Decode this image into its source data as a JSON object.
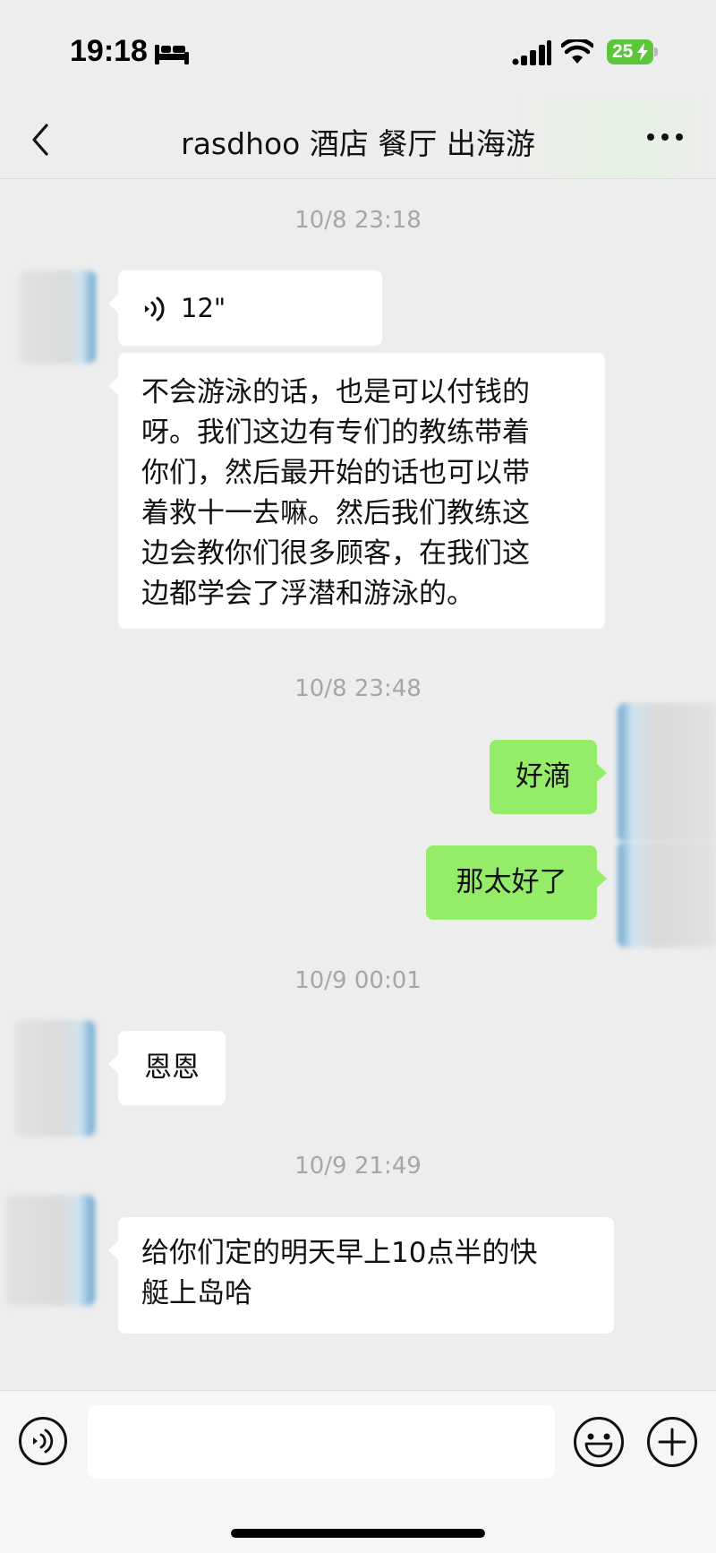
{
  "status_bar": {
    "time": "19:18",
    "battery": "25"
  },
  "nav": {
    "title": "rasdhoo  酒店 餐厅 出海游"
  },
  "messages": {
    "ts1": "10/8 23:18",
    "voice_duration": "12\"",
    "m1_lines": [
      "不会游泳的话，也是可以付钱的",
      "呀。我们这边有专们的教练带着",
      "你们，然后最开始的话也可以带",
      "着救十一去嘛。然后我们教练这",
      "边会教你们很多顾客，在我们这",
      "边都学会了浮潜和游泳的。"
    ],
    "ts2": "10/8 23:48",
    "m2": "好滴",
    "m3": "那太好了",
    "ts3": "10/9 00:01",
    "m4": "恩恩",
    "ts4": "10/9 21:49",
    "m5_lines": [
      "给你们定的明天早上10点半的快",
      "艇上岛哈"
    ]
  },
  "colors": {
    "background": "#ededed",
    "incoming_bubble": "#ffffff",
    "outgoing_bubble": "#95ec69",
    "battery": "#5cc63b"
  },
  "icons": [
    "bed-icon",
    "signal-icon",
    "wifi-icon",
    "back-icon",
    "more-icon",
    "voice-message-icon",
    "voice-input-icon",
    "emoji-icon",
    "plus-icon"
  ]
}
